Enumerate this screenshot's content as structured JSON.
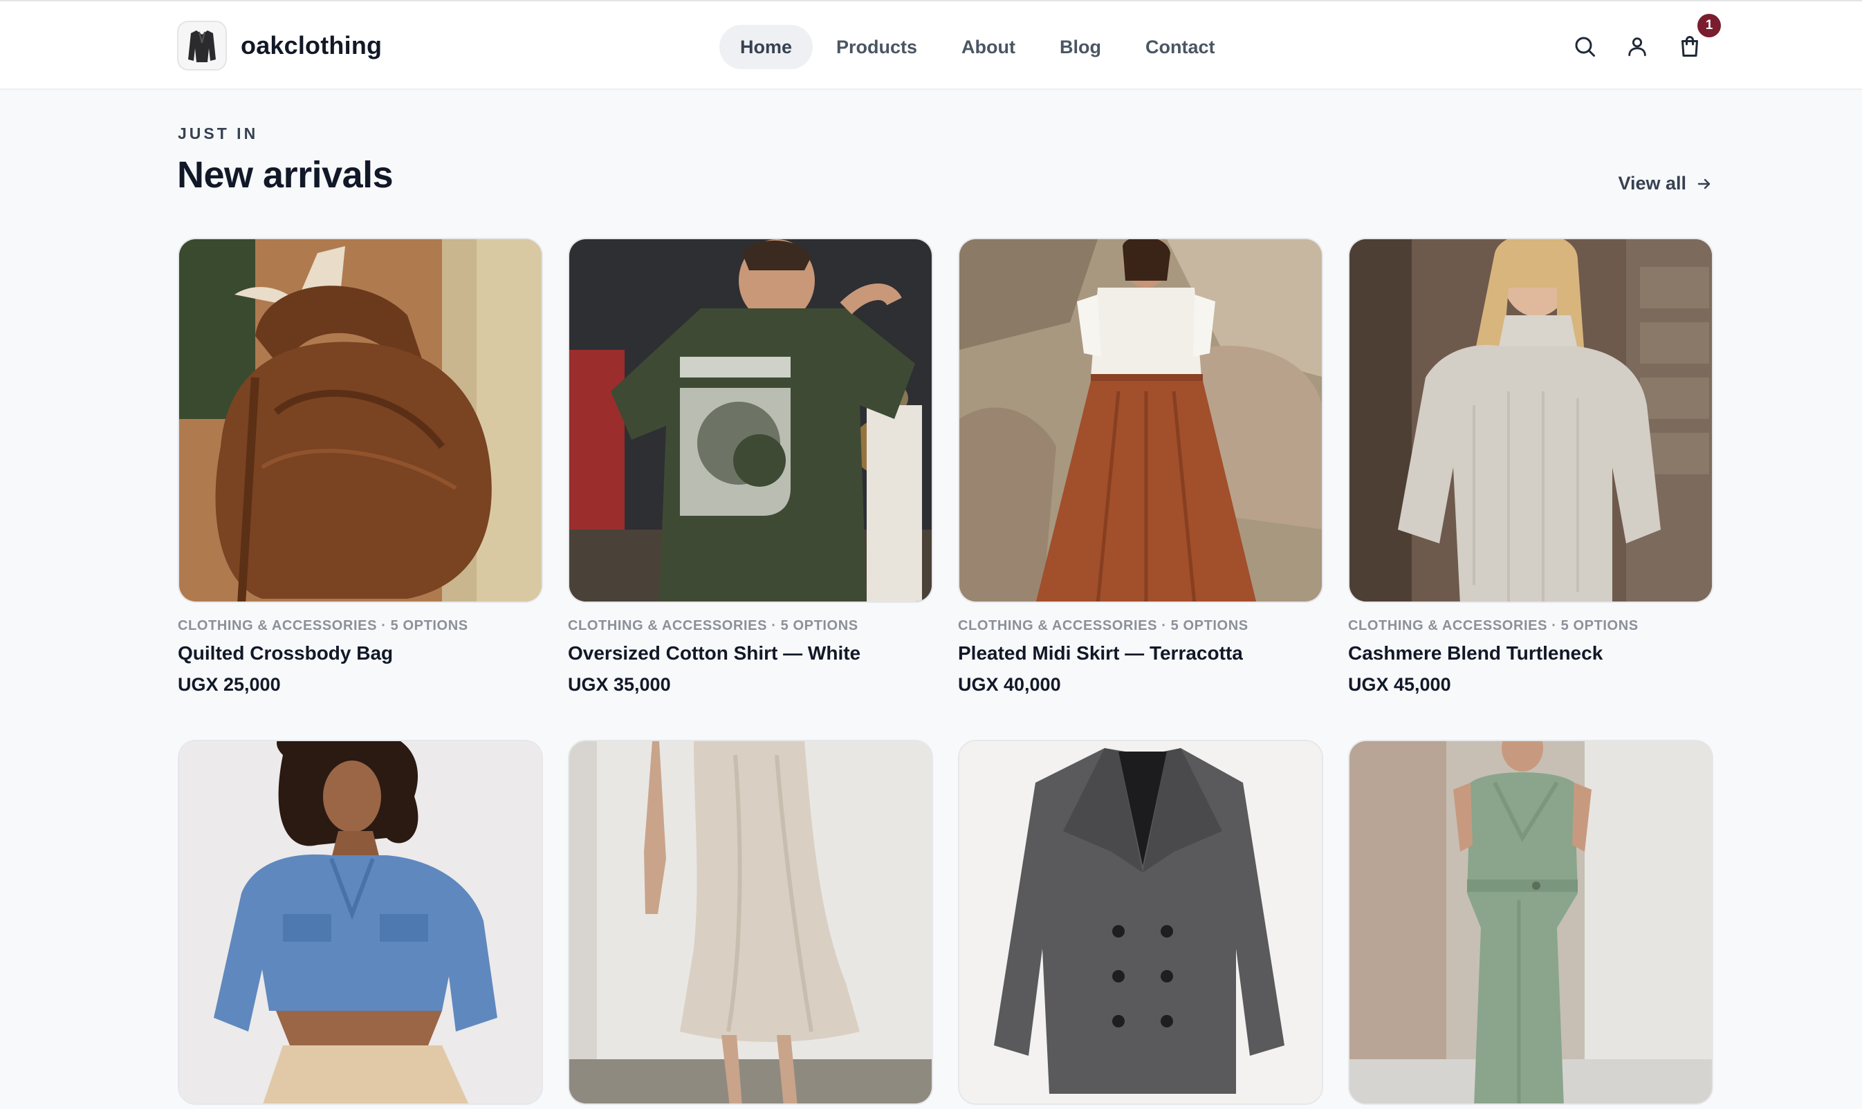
{
  "brand": {
    "name": "oakclothing",
    "logo_icon": "blazer-logo-icon"
  },
  "nav": {
    "items": [
      {
        "label": "Home",
        "active": true
      },
      {
        "label": "Products",
        "active": false
      },
      {
        "label": "About",
        "active": false
      },
      {
        "label": "Blog",
        "active": false
      },
      {
        "label": "Contact",
        "active": false
      }
    ]
  },
  "header_icons": {
    "search": "search-icon",
    "account": "user-icon",
    "cart": "shopping-bag-icon",
    "cart_count": "1"
  },
  "section": {
    "eyebrow": "JUST IN",
    "title": "New arrivals",
    "view_all": "View all"
  },
  "products": [
    {
      "meta": "CLOTHING & ACCESSORIES · 5 OPTIONS",
      "name": "Quilted Crossbody Bag",
      "price": "UGX 25,000",
      "image": "brown-leather-bag-photo"
    },
    {
      "meta": "CLOTHING & ACCESSORIES · 5 OPTIONS",
      "name": "Oversized Cotton Shirt — White",
      "price": "UGX 35,000",
      "image": "olive-graphic-tee-photo"
    },
    {
      "meta": "CLOTHING & ACCESSORIES · 5 OPTIONS",
      "name": "Pleated Midi Skirt — Terracotta",
      "price": "UGX 40,000",
      "image": "terracotta-skirt-photo"
    },
    {
      "meta": "CLOTHING & ACCESSORIES · 5 OPTIONS",
      "name": "Cashmere Blend Turtleneck",
      "price": "UGX 45,000",
      "image": "cream-turtleneck-photo"
    },
    {
      "image": "denim-crop-jacket-photo"
    },
    {
      "image": "satin-slip-skirt-photo"
    },
    {
      "image": "grey-double-breasted-blazer-photo"
    },
    {
      "image": "sage-wrap-jumpsuit-photo"
    }
  ],
  "colors": {
    "background": "#f8f9fb",
    "badge": "#7a1d2e",
    "text": "#111827",
    "muted": "#8b9099"
  }
}
